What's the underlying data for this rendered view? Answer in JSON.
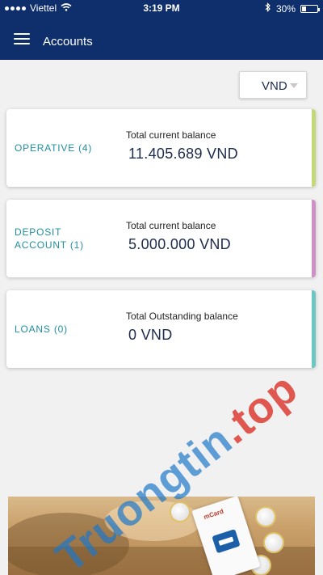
{
  "status_bar": {
    "carrier": "Viettel",
    "time": "3:19 PM",
    "battery": "30%",
    "battery_level": 0.3
  },
  "header": {
    "title": "Accounts"
  },
  "currency": {
    "selected": "VND"
  },
  "cards": [
    {
      "category": "OPERATIVE (4)",
      "label": "Total current balance",
      "amount": "11.405.689 VND",
      "accent_color": "#c2d97a"
    },
    {
      "category": "DEPOSIT ACCOUNT (1)",
      "label": "Total current balance",
      "amount": "5.000.000 VND",
      "accent_color": "#cf8fc7"
    },
    {
      "category": "LOANS (0)",
      "label": "Total Outstanding balance",
      "amount": "0 VND",
      "accent_color": "#6cc6c2"
    }
  ],
  "banner": {
    "brand": "mCard"
  },
  "watermark": {
    "text_main": "Truongtin",
    "text_suffix": ".top"
  }
}
